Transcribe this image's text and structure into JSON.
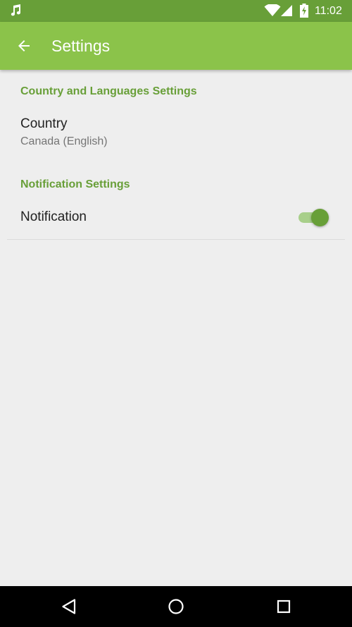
{
  "status_bar": {
    "time": "11:02",
    "icons": [
      "music-icon",
      "wifi-icon",
      "signal-icon",
      "battery-charging-icon"
    ]
  },
  "app_bar": {
    "title": "Settings",
    "back_icon": "arrow-back-icon"
  },
  "categories": {
    "country": {
      "title": "Country and Languages Settings",
      "items": [
        {
          "title": "Country",
          "summary": "Canada (English)"
        }
      ]
    },
    "notification": {
      "title": "Notification Settings",
      "items": [
        {
          "title": "Notification",
          "toggle_on": true
        }
      ]
    }
  },
  "nav_bar": {
    "buttons": [
      "back-triangle-icon",
      "home-circle-icon",
      "recents-square-icon"
    ]
  },
  "colors": {
    "status_bar": "#689f38",
    "app_bar": "#8bc34a",
    "accent": "#689f38",
    "background": "#eeeeee"
  }
}
